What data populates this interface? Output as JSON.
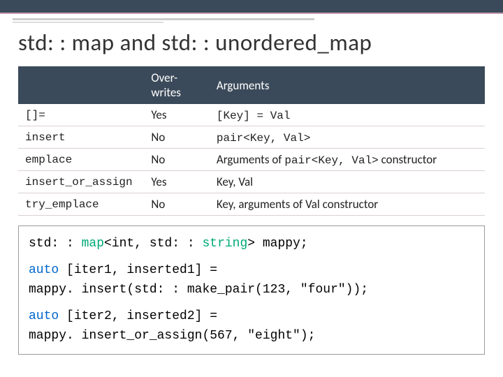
{
  "title": "std: : map and std: : unordered_map",
  "table": {
    "headers": {
      "col1": "",
      "col2": "Over-writes",
      "col3": "Arguments"
    },
    "rows": [
      {
        "fn": "[]=",
        "ow": "Yes",
        "args_pre": "",
        "args_mono": "[Key] = Val",
        "args_post": ""
      },
      {
        "fn": "insert",
        "ow": "No",
        "args_pre": "",
        "args_mono": "pair<Key, Val>",
        "args_post": ""
      },
      {
        "fn": "emplace",
        "ow": "No",
        "args_pre": "Arguments of ",
        "args_mono": "pair<Key, Val>",
        "args_post": " constructor"
      },
      {
        "fn": "insert_or_assign",
        "ow": "Yes",
        "args_pre": "Key, Val",
        "args_mono": "",
        "args_post": ""
      },
      {
        "fn": "try_emplace",
        "ow": "No",
        "args_pre": "Key, arguments of Val constructor",
        "args_mono": "",
        "args_post": ""
      }
    ]
  },
  "code": {
    "l1a": "std: : ",
    "l1b": "map",
    "l1c": "<int, std: : ",
    "l1d": "string",
    "l1e": "> mappy;",
    "l2a": "auto",
    "l2b": " [iter1, inserted1] =",
    "l3": "   mappy. insert(std: : make_pair(123, \"four\"));",
    "l4a": "auto",
    "l4b": " [iter2, inserted2] =",
    "l5": "   mappy. insert_or_assign(567, \"eight\");"
  }
}
